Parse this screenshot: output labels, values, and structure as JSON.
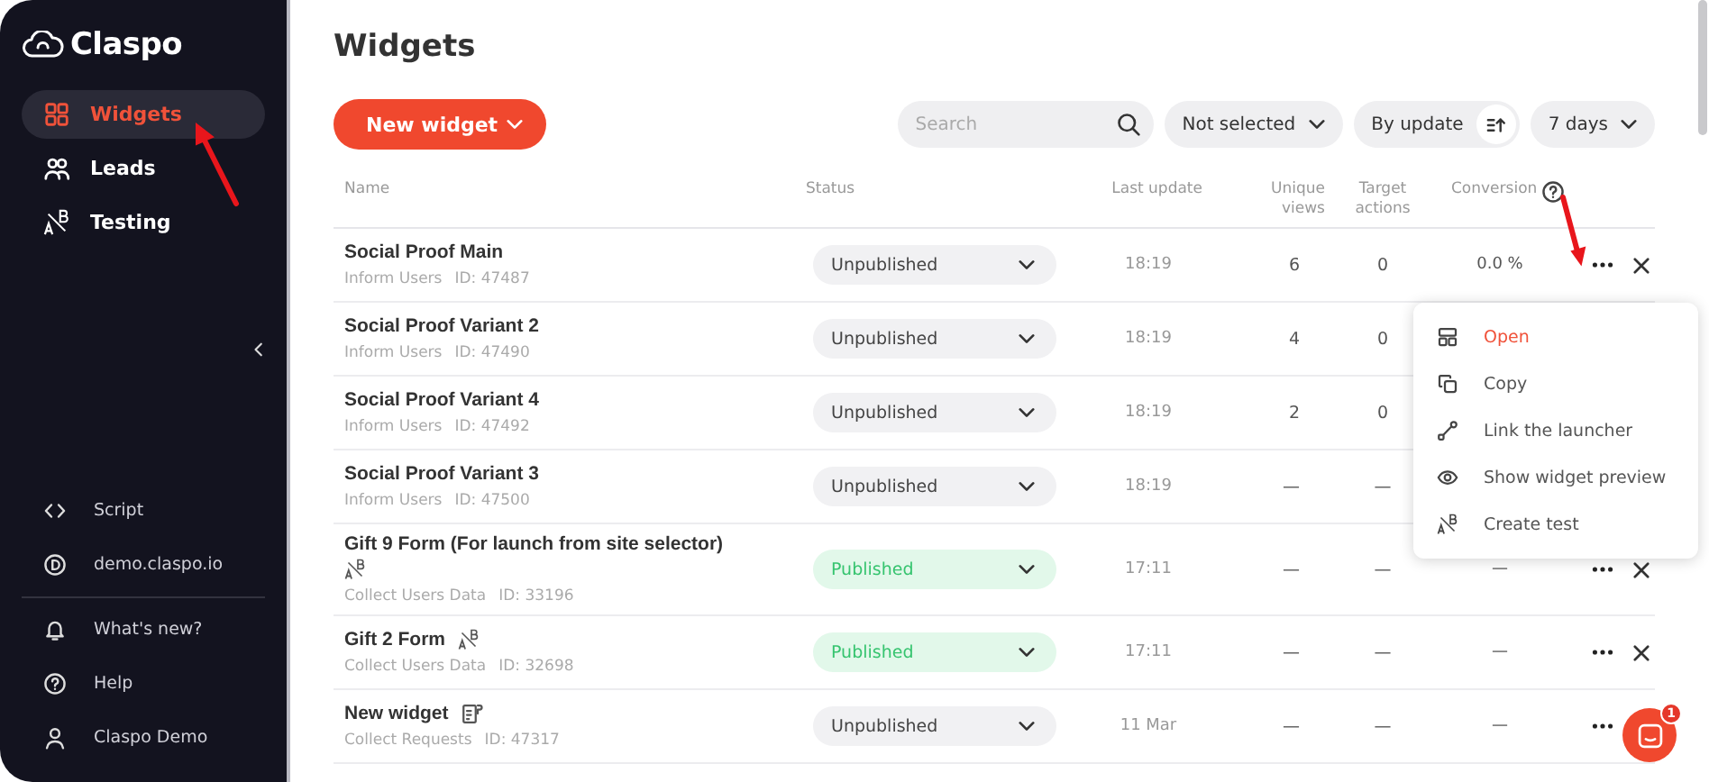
{
  "sidebar": {
    "logo": "Claspo",
    "nav": [
      {
        "label": "Widgets",
        "selected": true
      },
      {
        "label": "Leads",
        "selected": false
      },
      {
        "label": "Testing",
        "selected": false
      }
    ],
    "bottom": [
      "Script",
      "demo.claspo.io",
      "What's new?",
      "Help",
      "Claspo Demo"
    ]
  },
  "page": {
    "title": "Widgets"
  },
  "toolbar": {
    "new_button": "New widget",
    "search": {
      "placeholder": "Search"
    },
    "filter": "Not selected",
    "sort": "By update",
    "period": "7 days"
  },
  "table": {
    "columns": [
      "Name",
      "Status",
      "Last update",
      "Unique views",
      "Target actions",
      "Conversion"
    ],
    "rows": [
      {
        "name": "Social Proof Main",
        "kind": "plain",
        "type": "Inform Users",
        "id": "ID: 47487",
        "status": "Unpublished",
        "published": false,
        "updated": "18:19",
        "views": "6",
        "actions_count": "0",
        "conversion": "0.0 %"
      },
      {
        "name": "Social Proof Variant 2",
        "kind": "plain",
        "type": "Inform Users",
        "id": "ID: 47490",
        "status": "Unpublished",
        "published": false,
        "updated": "18:19",
        "views": "4",
        "actions_count": "0"
      },
      {
        "name": "Social Proof Variant 4",
        "kind": "plain",
        "type": "Inform Users",
        "id": "ID: 47492",
        "status": "Unpublished",
        "published": false,
        "updated": "18:19",
        "views": "2",
        "actions_count": "0"
      },
      {
        "name": "Social Proof Variant 3",
        "kind": "plain",
        "type": "Inform Users",
        "id": "ID: 47500",
        "status": "Unpublished",
        "published": false,
        "updated": "18:19",
        "views": "—",
        "actions_count": "—"
      },
      {
        "name": "Gift 9 Form (For launch from site selector)",
        "kind": "ab_test",
        "type": "Collect Users Data",
        "id": "ID: 33196",
        "status": "Published",
        "published": true,
        "updated": "17:11",
        "views": "—",
        "actions_count": "—",
        "conversion": "—"
      },
      {
        "name": "Gift 2 Form",
        "kind": "ab_test",
        "type": "Collect Users Data",
        "id": "ID: 32698",
        "status": "Published",
        "published": true,
        "updated": "17:11",
        "views": "—",
        "actions_count": "—",
        "conversion": "—"
      },
      {
        "name": "New widget",
        "kind": "request_form",
        "type": "Collect Requests",
        "id": "ID: 47317",
        "status": "Unpublished",
        "published": false,
        "updated": "11 Mar",
        "views": "—",
        "actions_count": "—",
        "conversion": "—"
      }
    ]
  },
  "context_menu": {
    "items": [
      {
        "label": "Open",
        "selected": true
      },
      {
        "label": "Copy",
        "selected": false
      },
      {
        "label": "Link the launcher",
        "selected": false
      },
      {
        "label": "Show widget preview",
        "selected": false
      },
      {
        "label": "Create test",
        "selected": false
      }
    ]
  },
  "chat": {
    "badge": "1"
  }
}
